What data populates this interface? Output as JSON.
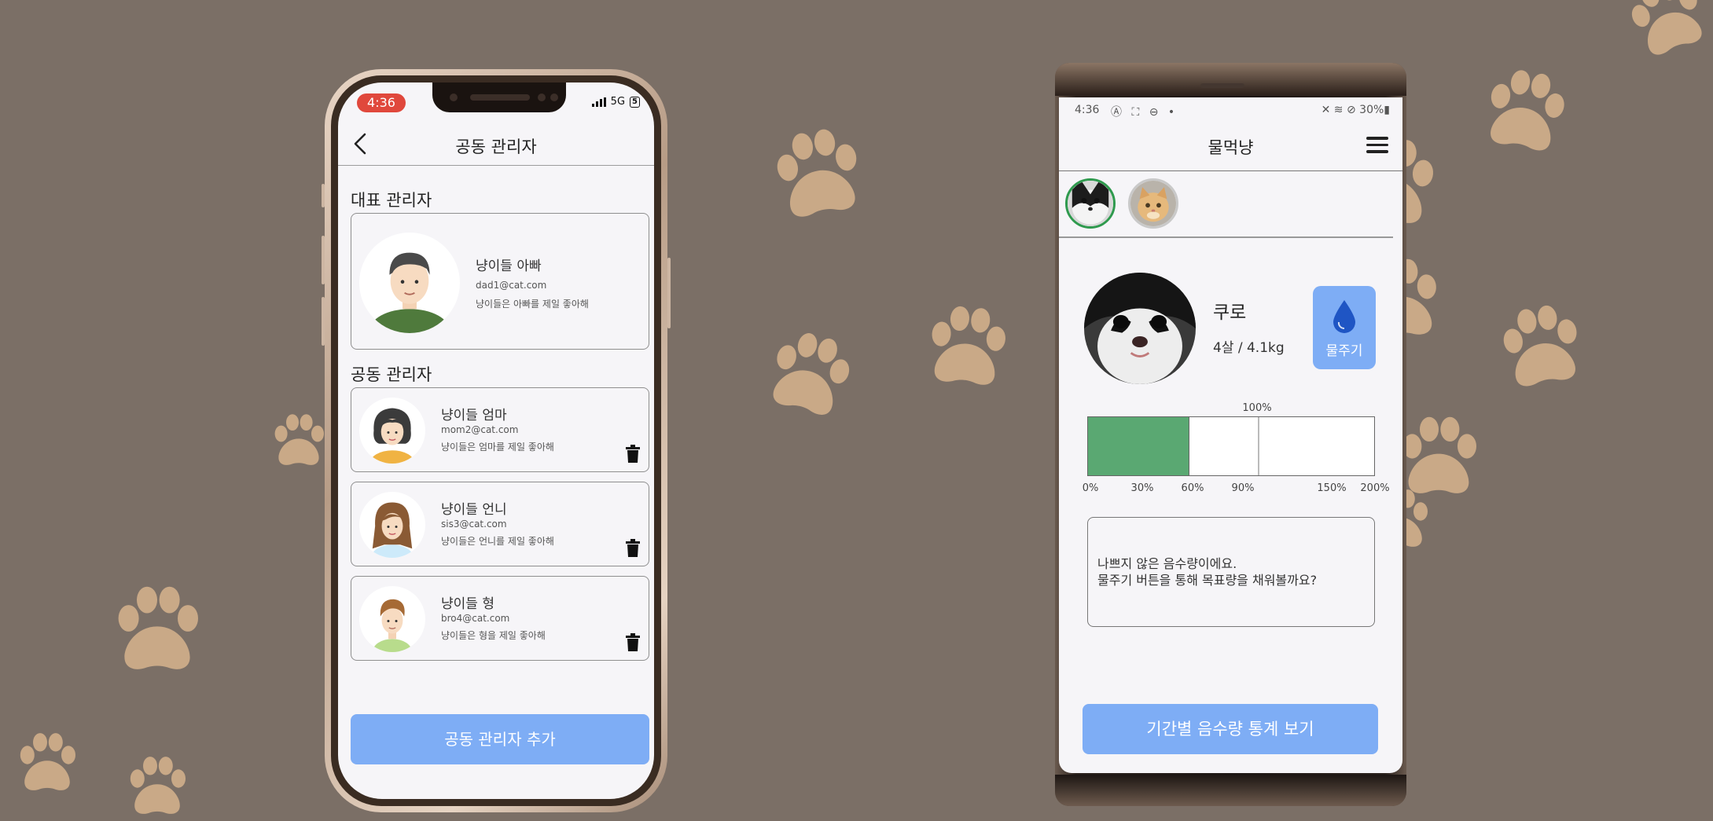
{
  "colors": {
    "background": "#7b6f66",
    "paw": "#c9a987",
    "accent_blue": "#7eadf5",
    "gauge_green": "#5aa872",
    "time_pill": "#e0483c"
  },
  "left_phone": {
    "status": {
      "time": "4:36",
      "network": "5G",
      "battery": "5"
    },
    "title": "공동 관리자",
    "main_label": "대표 관리자",
    "main_manager": {
      "name": "냥이들 아빠",
      "email": "dad1@cat.com",
      "message": "냥이들은 아빠를 제일 좋아해",
      "avatar": "man-avatar"
    },
    "co_label": "공동 관리자",
    "co_managers": [
      {
        "name": "냥이들 엄마",
        "email": "mom2@cat.com",
        "message": "냥이들은 엄마를 제일 좋아해",
        "avatar": "woman-avatar"
      },
      {
        "name": "냥이들 언니",
        "email": "sis3@cat.com",
        "message": "냥이들은 언니를 제일 좋아해",
        "avatar": "girl-avatar"
      },
      {
        "name": "냥이들 형",
        "email": "bro4@cat.com",
        "message": "냥이들은 형을 제일 좋아해",
        "avatar": "boy-avatar"
      }
    ],
    "add_button": "공동 관리자 추가"
  },
  "right_phone": {
    "status": {
      "time": "4:36",
      "icons": "Ⓐ ⛶ ⊖ •",
      "right": "✕ ≋ ⊘ 30%▮"
    },
    "title": "물먹냥",
    "cat": {
      "name": "쿠로",
      "info": "4살 / 4.1kg"
    },
    "water_button": "물주기",
    "gauge": {
      "value_percent": 78,
      "target_label": "100%",
      "target_percent": 100,
      "max_percent": 200,
      "ticks": [
        {
          "label": "0%",
          "value": 0
        },
        {
          "label": "30%",
          "value": 30
        },
        {
          "label": "60%",
          "value": 60
        },
        {
          "label": "90%",
          "value": 90
        },
        {
          "label": "150%",
          "value": 150
        },
        {
          "label": "200%",
          "value": 200
        }
      ]
    },
    "message_line1": "나쁘지 않은 음수량이에요.",
    "message_line2": "물주기 버튼을 통해 목표량을 채워볼까요?",
    "stats_button": "기간별 음수량 통계 보기"
  }
}
